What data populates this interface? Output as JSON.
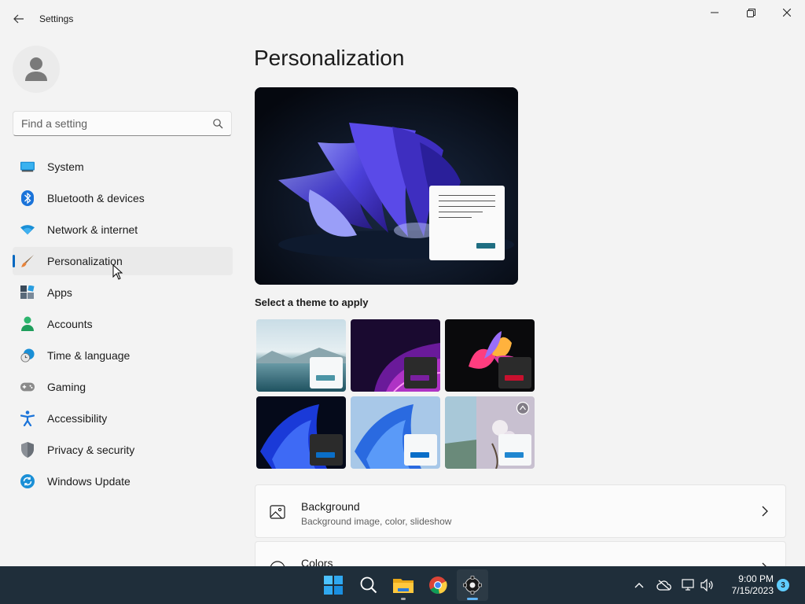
{
  "window": {
    "title": "Settings",
    "back_icon": "back-arrow-icon",
    "minimize_icon": "minimize-icon",
    "restore_icon": "restore-icon",
    "close_icon": "close-icon"
  },
  "sidebar": {
    "search_placeholder": "Find a setting",
    "items": [
      {
        "label": "System",
        "icon": "system-icon"
      },
      {
        "label": "Bluetooth & devices",
        "icon": "bluetooth-icon"
      },
      {
        "label": "Network & internet",
        "icon": "wifi-icon"
      },
      {
        "label": "Personalization",
        "icon": "paintbrush-icon",
        "selected": true
      },
      {
        "label": "Apps",
        "icon": "apps-icon"
      },
      {
        "label": "Accounts",
        "icon": "accounts-icon"
      },
      {
        "label": "Time & language",
        "icon": "time-language-icon"
      },
      {
        "label": "Gaming",
        "icon": "gamepad-icon"
      },
      {
        "label": "Accessibility",
        "icon": "accessibility-icon"
      },
      {
        "label": "Privacy & security",
        "icon": "shield-icon"
      },
      {
        "label": "Windows Update",
        "icon": "update-icon"
      }
    ]
  },
  "main": {
    "page_title": "Personalization",
    "themes_label": "Select a theme to apply",
    "themes": [
      {
        "name": "theme-1",
        "accent": "#4b95a6"
      },
      {
        "name": "theme-2",
        "accent": "#7a1fa0"
      },
      {
        "name": "theme-3",
        "accent": "#c8102e"
      },
      {
        "name": "theme-4",
        "accent": "#0a6ec8"
      },
      {
        "name": "theme-5",
        "accent": "#0a6ec8"
      },
      {
        "name": "theme-6",
        "accent": "#1f86d0"
      }
    ],
    "cards": [
      {
        "title": "Background",
        "subtitle": "Background image, color, slideshow",
        "icon": "image-icon"
      },
      {
        "title": "Colors",
        "subtitle": "",
        "icon": "palette-icon"
      }
    ]
  },
  "taskbar": {
    "apps": [
      "windows-start-icon",
      "search-icon",
      "file-explorer-icon",
      "chrome-icon",
      "settings-gear-icon"
    ],
    "time": "9:00 PM",
    "date": "7/15/2023",
    "notification_count": "3"
  },
  "colors": {
    "accent": "#0067c0",
    "taskbar": "#1f2e3a",
    "background": "#f3f3f3"
  }
}
